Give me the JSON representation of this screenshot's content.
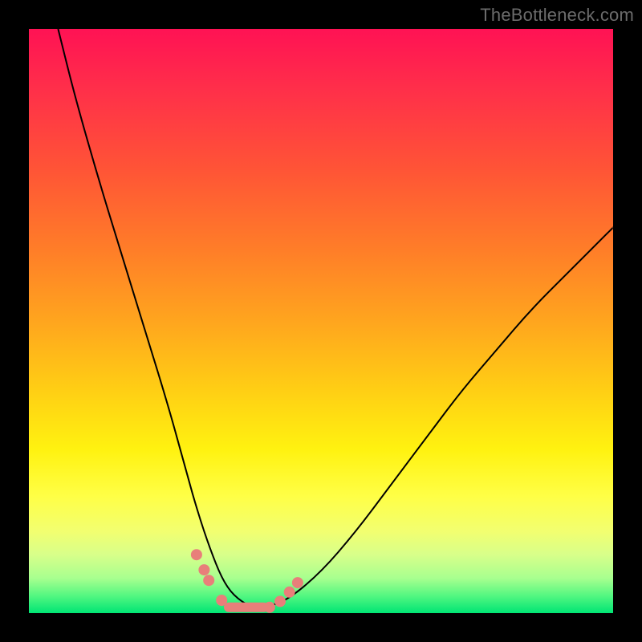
{
  "watermark": "TheBottleneck.com",
  "accent_color": "#e87f7a",
  "chart_data": {
    "type": "line",
    "title": "",
    "xlabel": "",
    "ylabel": "",
    "xlim": [
      0,
      100
    ],
    "ylim": [
      0,
      100
    ],
    "series": [
      {
        "name": "curve",
        "x": [
          5,
          8,
          12,
          16,
          20,
          24,
          27,
          29,
          31,
          33,
          35,
          38,
          40,
          44,
          50,
          56,
          62,
          68,
          74,
          80,
          86,
          92,
          100
        ],
        "y": [
          100,
          88,
          74,
          61,
          48,
          35,
          24,
          17,
          11,
          6,
          3,
          1,
          1,
          2,
          7,
          14,
          22,
          30,
          38,
          45,
          52,
          58,
          66
        ]
      }
    ],
    "markers": [
      {
        "kind": "dot",
        "x": 28.7,
        "y": 10.0
      },
      {
        "kind": "dot",
        "x": 30.0,
        "y": 7.4
      },
      {
        "kind": "dot",
        "x": 30.8,
        "y": 5.6
      },
      {
        "kind": "dot",
        "x": 33.0,
        "y": 2.2
      },
      {
        "kind": "dot",
        "x": 41.2,
        "y": 1.0
      },
      {
        "kind": "dot",
        "x": 43.0,
        "y": 2.0
      },
      {
        "kind": "dot",
        "x": 44.6,
        "y": 3.6
      },
      {
        "kind": "dot",
        "x": 46.0,
        "y": 5.2
      },
      {
        "kind": "segment",
        "x1": 34.2,
        "y1": 1.0,
        "x2": 40.2,
        "y2": 1.0
      }
    ]
  }
}
